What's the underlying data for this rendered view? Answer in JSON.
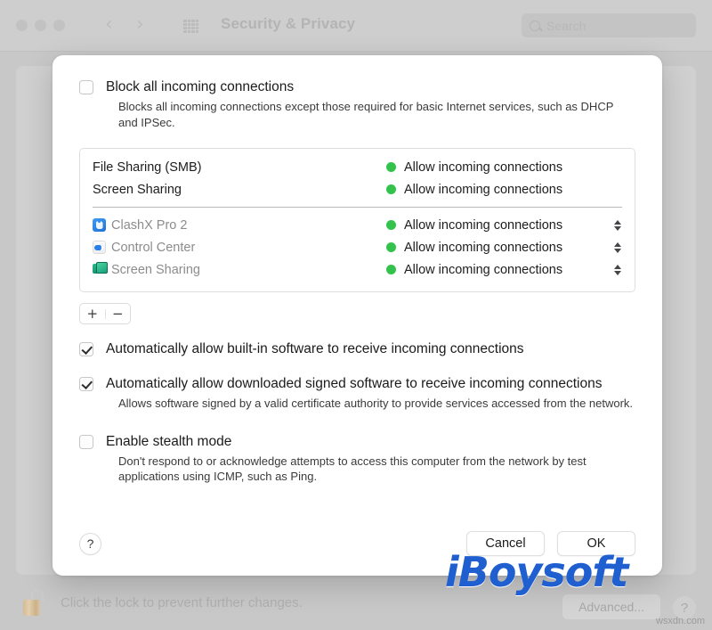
{
  "window": {
    "title": "Security & Privacy",
    "search_placeholder": "Search",
    "traffic_lights": [
      "close",
      "minimize",
      "zoom"
    ],
    "nav_back": "‹",
    "nav_forward": "›",
    "lock_text": "Click the lock to prevent further changes.",
    "advanced_label": "Advanced...",
    "help_label": "?"
  },
  "sheet": {
    "block_all": {
      "label": "Block all incoming connections",
      "checked": false,
      "description": "Blocks all incoming connections except those required for basic Internet services, such as DHCP and IPSec."
    },
    "services": [
      {
        "name": "File Sharing (SMB)",
        "status": "Allow incoming connections",
        "dot_color": "#33c34c",
        "icon": null,
        "stepper": false
      },
      {
        "name": "Screen Sharing",
        "status": "Allow incoming connections",
        "dot_color": "#33c34c",
        "icon": null,
        "stepper": false
      }
    ],
    "apps": [
      {
        "name": "ClashX Pro 2",
        "status": "Allow incoming connections",
        "dot_color": "#33c34c",
        "icon": "clashx-app-icon",
        "stepper": true
      },
      {
        "name": "Control Center",
        "status": "Allow incoming connections",
        "dot_color": "#33c34c",
        "icon": "control-center-app-icon",
        "stepper": true
      },
      {
        "name": "Screen Sharing",
        "status": "Allow incoming connections",
        "dot_color": "#33c34c",
        "icon": "screen-sharing-app-icon",
        "stepper": true
      }
    ],
    "add_label": "+",
    "remove_label": "−",
    "auto_builtin": {
      "label": "Automatically allow built-in software to receive incoming connections",
      "checked": true
    },
    "auto_signed": {
      "label": "Automatically allow downloaded signed software to receive incoming connections",
      "checked": true,
      "description": "Allows software signed by a valid certificate authority to provide services accessed from the network."
    },
    "stealth": {
      "label": "Enable stealth mode",
      "checked": false,
      "description": "Don't respond to or acknowledge attempts to access this computer from the network by test applications using ICMP, such as Ping."
    },
    "help_label": "?",
    "cancel_label": "Cancel",
    "ok_label": "OK"
  },
  "watermark": {
    "text": "iBoysoft",
    "site": "wsxdn.com"
  }
}
